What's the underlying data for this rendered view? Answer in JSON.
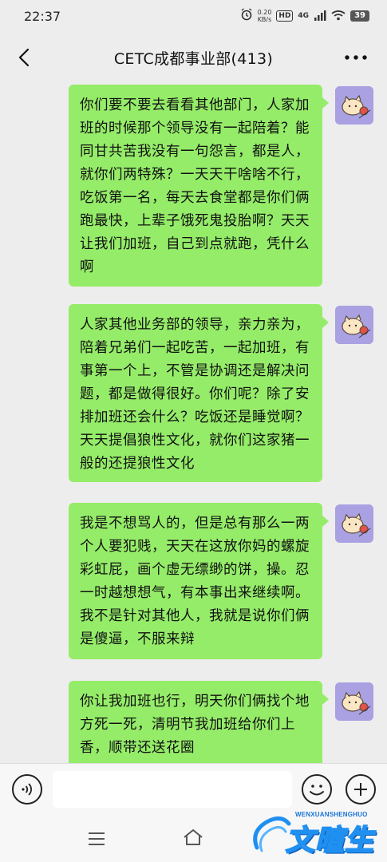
{
  "status_bar": {
    "time": "22:37",
    "net_speed_value": "0.20",
    "net_speed_unit": "KB/s",
    "hd_label": "HD",
    "signal_label": "4G",
    "battery": "39"
  },
  "header": {
    "title": "CETC成都事业部(413)"
  },
  "messages": [
    {
      "text": "你们要不要去看看其他部门，人家加班的时候那个领导没有一起陪着？能同甘共苦我没有一句怨言，都是人，就你们两特殊？一天天干啥啥不行，吃饭第一名，每天去食堂都是你们俩跑最快，上辈子饿死鬼投胎啊？天天让我们加班，自己到点就跑，凭什么啊"
    },
    {
      "text": "人家其他业务部的领导，亲力亲为，陪着兄弟们一起吃苦，一起加班，有事第一个上，不管是协调还是解决问题，都是做得很好。你们呢？除了安排加班还会什么？吃饭还是睡觉啊？天天提倡狼性文化，就你们这家猪一般的还提狼性文化"
    },
    {
      "text": "我是不想骂人的，但是总有那么一两个人要犯贱，天天在这放你妈的螺旋彩虹屁，画个虚无缥缈的饼，操。忍一时越想想气，有本事出来继续啊。我不是针对其他人，我就是说你们俩是傻逼，不服来辩"
    },
    {
      "text": "你让我加班也行，明天你们俩找个地方死一死，清明节我加班给你们上香，顺带还送花圈"
    }
  ],
  "input_bar": {
    "placeholder": ""
  },
  "watermark": {
    "pinyin": "WENXUANSHENGHUO",
    "chinese": "文暄生活"
  },
  "colors": {
    "bubble": "#95ec69",
    "avatar_bg": "#a9a1e2",
    "background": "#ededed"
  }
}
